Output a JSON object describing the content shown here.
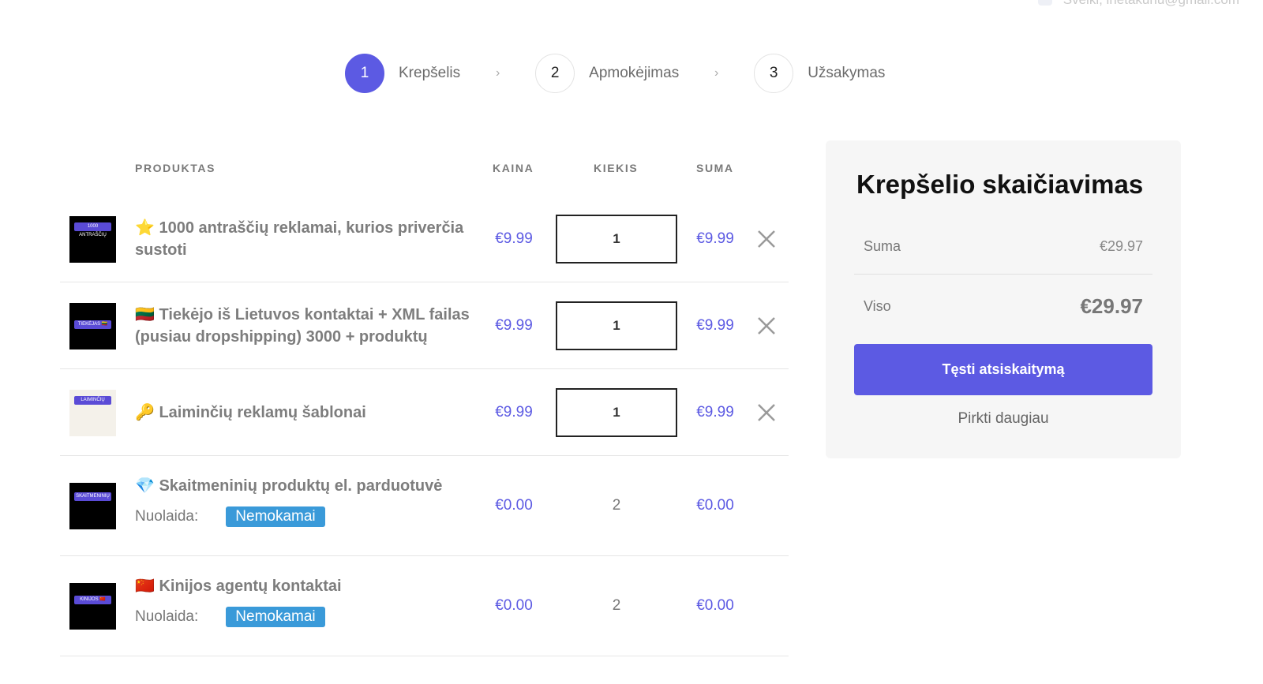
{
  "topbar": {
    "greeting": "Sveiki, irietakunu@gmail.com"
  },
  "steps": [
    {
      "num": "1",
      "label": "Krepšelis"
    },
    {
      "num": "2",
      "label": "Apmokėjimas"
    },
    {
      "num": "3",
      "label": "Užsakymas"
    }
  ],
  "step_separator": "›",
  "table": {
    "headers": {
      "product": "PRODUKTAS",
      "price": "KAINA",
      "qty": "KIEKIS",
      "total": "SUMA"
    },
    "rows": [
      {
        "thumb_label": "1000 ANTRAŠČIŲ",
        "name": "⭐ 1000 antraščių reklamai, kurios priverčia sustoti",
        "price": "€9.99",
        "qty": "1",
        "total": "€9.99"
      },
      {
        "thumb_label": "TIEKĖJAS 🇱🇹",
        "name": "🇱🇹 Tiekėjo iš Lietuvos kontaktai + XML failas (pusiau dropshipping) 3000 + produktų",
        "price": "€9.99",
        "qty": "1",
        "total": "€9.99"
      },
      {
        "thumb_label": "LAIMINČIŲ",
        "name": "🔑 Laiminčių reklamų šablonai",
        "price": "€9.99",
        "qty": "1",
        "total": "€9.99"
      },
      {
        "thumb_label": "SKAITMENINIŲ",
        "name": "💎 Skaitmeninių produktų el. parduotuvė",
        "discount_label": "Nuolaida:",
        "discount_badge": "Nemokamai",
        "price": "€0.00",
        "qty": "2",
        "total": "€0.00"
      },
      {
        "thumb_label": "KINIJOS 🇨🇳",
        "name": "🇨🇳 Kinijos agentų kontaktai",
        "discount_label": "Nuolaida:",
        "discount_badge": "Nemokamai",
        "price": "€0.00",
        "qty": "2",
        "total": "€0.00"
      }
    ]
  },
  "summary": {
    "title": "Krepšelio skaičiavimas",
    "subtotal_label": "Suma",
    "subtotal_value": "€29.97",
    "total_label": "Viso",
    "total_value": "€29.97",
    "checkout_label": "Tęsti atsiskaitymą",
    "more_label": "Pirkti daugiau"
  },
  "colors": {
    "accent": "#5c5ae3",
    "badge": "#3a9ad9"
  }
}
